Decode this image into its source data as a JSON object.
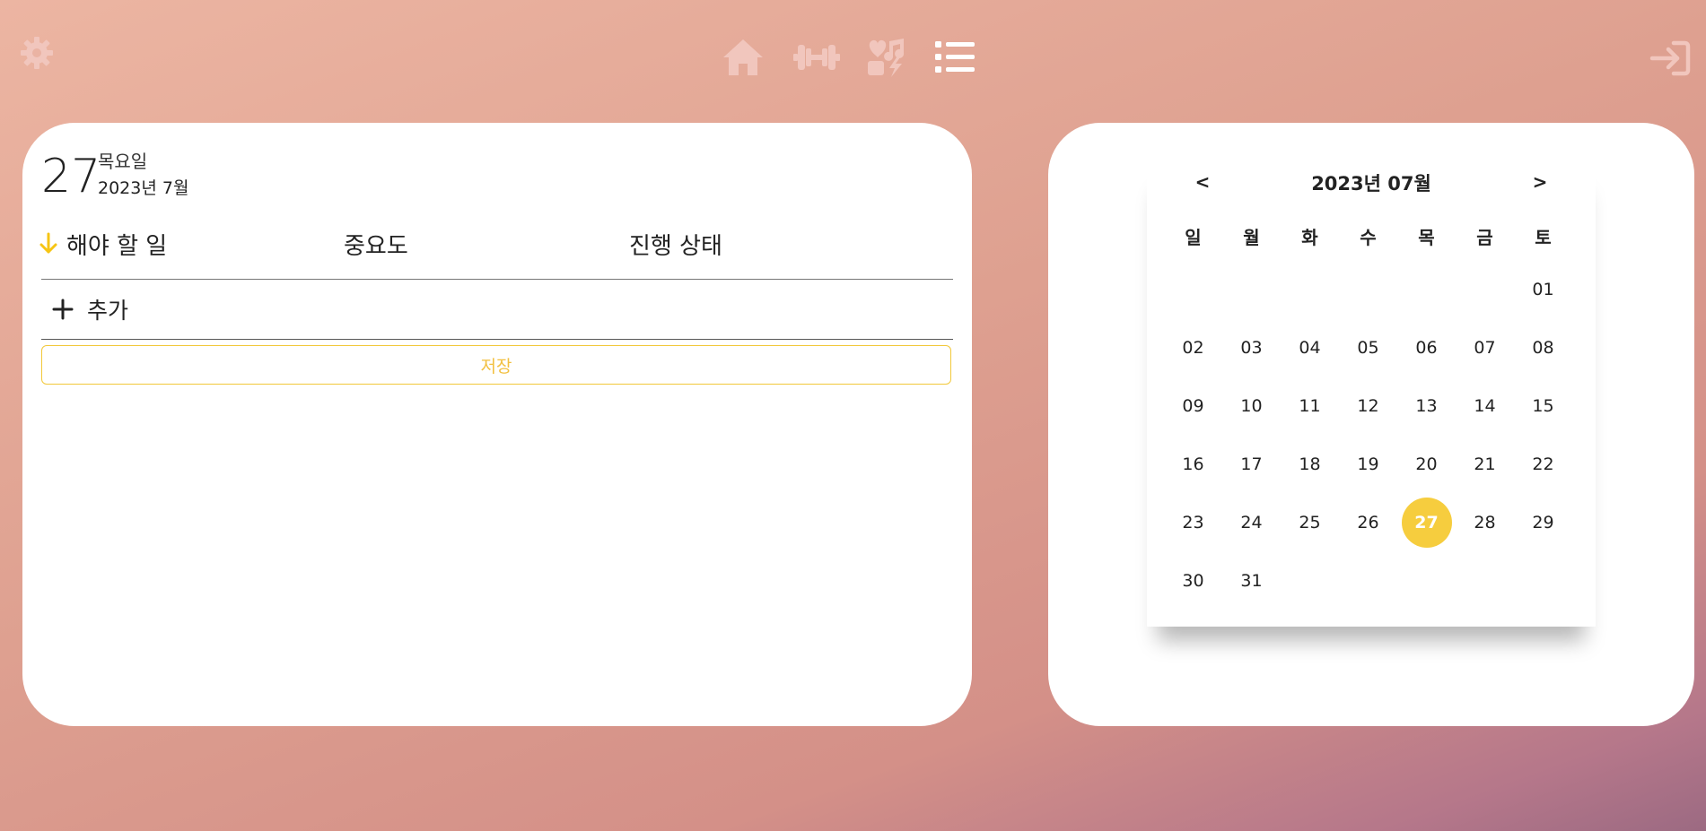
{
  "colors": {
    "accent": "#f6cd3e",
    "nav_icon": "#f1c6bd",
    "nav_icon_active": "#ffffff"
  },
  "header": {
    "settings_icon": "gear-icon",
    "logout_icon": "login-arrow-icon",
    "nav": [
      {
        "icon": "home-icon",
        "active": false
      },
      {
        "icon": "dumbbell-icon",
        "active": false
      },
      {
        "icon": "heart-music-icon",
        "active": false
      },
      {
        "icon": "list-icon",
        "active": true
      }
    ]
  },
  "todo": {
    "day": "27",
    "weekday": "목요일",
    "year_month": "2023년 7월",
    "columns": [
      "해야 할 일",
      "중요도",
      "진행 상태"
    ],
    "add_label": "추가",
    "save_label": "저장"
  },
  "calendar": {
    "prev_label": "<",
    "next_label": ">",
    "title": "2023년 07월",
    "weekdays": [
      "일",
      "월",
      "화",
      "수",
      "목",
      "금",
      "토"
    ],
    "leading_blanks": 6,
    "days": [
      "01",
      "02",
      "03",
      "04",
      "05",
      "06",
      "07",
      "08",
      "09",
      "10",
      "11",
      "12",
      "13",
      "14",
      "15",
      "16",
      "17",
      "18",
      "19",
      "20",
      "21",
      "22",
      "23",
      "24",
      "25",
      "26",
      "27",
      "28",
      "29",
      "30",
      "31"
    ],
    "selected_day": "27"
  }
}
